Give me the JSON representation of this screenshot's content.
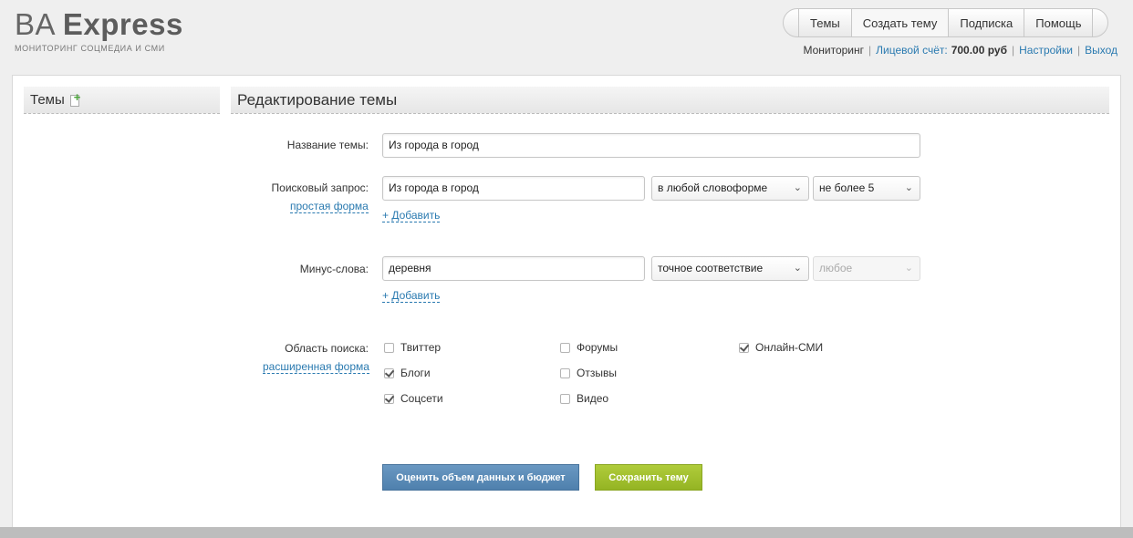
{
  "header": {
    "logo_ba": "BA",
    "logo_express": "Express",
    "logo_tagline": "МОНИТОРИНГ СОЦМЕДИА И СМИ"
  },
  "topnav": {
    "tabs": [
      {
        "label": "Темы",
        "active": false
      },
      {
        "label": "Создать тему",
        "active": true
      },
      {
        "label": "Подписка",
        "active": false
      },
      {
        "label": "Помощь",
        "active": false
      }
    ]
  },
  "userbar": {
    "monitoring": "Мониторинг",
    "account_label": "Лицевой счёт:",
    "account_value": "700.00 руб",
    "settings": "Настройки",
    "logout": "Выход"
  },
  "sidebar": {
    "title": "Темы",
    "add_icon": "add-document-icon"
  },
  "main": {
    "title": "Редактирование темы"
  },
  "form": {
    "topic_name": {
      "label": "Название темы:",
      "value": "Из города в город"
    },
    "query": {
      "label": "Поисковый запрос:",
      "mode_link": "простая форма",
      "value": "Из города в город",
      "wordform": "в любой словоформе",
      "distance": "не более 5",
      "add": "+ Добавить"
    },
    "minus": {
      "label": "Минус-слова:",
      "value": "деревня",
      "match": "точное соответствие",
      "distance": "любое",
      "add": "+ Добавить"
    },
    "scope": {
      "label": "Область поиска:",
      "mode_link": "расширенная форма",
      "options": [
        {
          "label": "Твиттер",
          "checked": false
        },
        {
          "label": "Блоги",
          "checked": true
        },
        {
          "label": "Соцсети",
          "checked": true
        },
        {
          "label": "Форумы",
          "checked": false
        },
        {
          "label": "Отзывы",
          "checked": false
        },
        {
          "label": "Видео",
          "checked": false
        },
        {
          "label": "Онлайн-СМИ",
          "checked": true
        }
      ]
    }
  },
  "buttons": {
    "estimate": "Оценить объем данных и бюджет",
    "save": "Сохранить тему"
  },
  "colors": {
    "link": "#2a7ab0",
    "estimate_button": "#5a8bb7",
    "save_button": "#a2c02f"
  }
}
